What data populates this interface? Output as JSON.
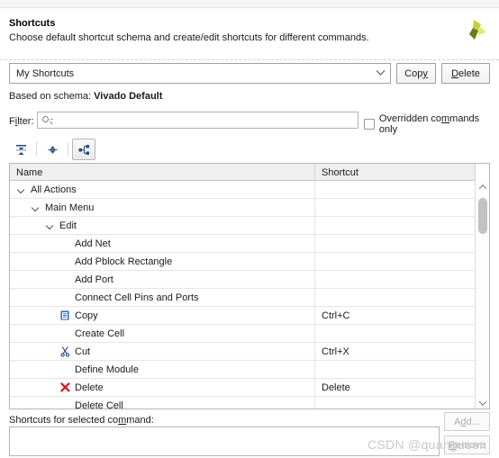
{
  "header": {
    "title": "Shortcuts",
    "subtitle": "Choose default shortcut schema and create/edit shortcuts for different commands.",
    "logo_icon": "vivado-pinwheel-logo-icon",
    "logo_colors": [
      "#a9b318",
      "#d7e14a",
      "#6e7a12"
    ]
  },
  "schema": {
    "combo_value": "My Shortcuts",
    "combo_icon": "chevron-down-icon",
    "copy_label_pre": "Cop",
    "copy_label_mn": "y",
    "delete_label_mn": "D",
    "delete_label_post": "elete",
    "based_on_prefix": "Based on schema: ",
    "based_on_value": "Vivado Default"
  },
  "filter": {
    "label_pre": "F",
    "label_mn": "i",
    "label_post": "lter:",
    "placeholder": "",
    "value": "",
    "search_icon": "search-icon",
    "checkbox_checked": false,
    "checkbox_label_pre": "Overridden co",
    "checkbox_label_mn": "m",
    "checkbox_label_post": "mands only"
  },
  "toolbar": {
    "buttons": [
      {
        "name": "collapse-all-icon",
        "pressed": false
      },
      {
        "name": "expand-all-icon",
        "pressed": false
      },
      {
        "name": "tree-hierarchy-icon",
        "pressed": true
      }
    ]
  },
  "table": {
    "columns": [
      "Name",
      "Shortcut"
    ],
    "rows": [
      {
        "label": "All Actions",
        "shortcut": "",
        "indent": 0,
        "twisty": true,
        "icon": ""
      },
      {
        "label": "Main Menu",
        "shortcut": "",
        "indent": 1,
        "twisty": true,
        "icon": ""
      },
      {
        "label": "Edit",
        "shortcut": "",
        "indent": 2,
        "twisty": true,
        "icon": ""
      },
      {
        "label": "Add Net",
        "shortcut": "",
        "indent": 3,
        "twisty": false,
        "icon": ""
      },
      {
        "label": "Add Pblock Rectangle",
        "shortcut": "",
        "indent": 3,
        "twisty": false,
        "icon": ""
      },
      {
        "label": "Add Port",
        "shortcut": "",
        "indent": 3,
        "twisty": false,
        "icon": ""
      },
      {
        "label": "Connect Cell Pins and Ports",
        "shortcut": "",
        "indent": 3,
        "twisty": false,
        "icon": ""
      },
      {
        "label": "Copy",
        "shortcut": "Ctrl+C",
        "indent": 3,
        "twisty": false,
        "icon": "copy-icon"
      },
      {
        "label": "Create Cell",
        "shortcut": "",
        "indent": 3,
        "twisty": false,
        "icon": ""
      },
      {
        "label": "Cut",
        "shortcut": "Ctrl+X",
        "indent": 3,
        "twisty": false,
        "icon": "cut-icon"
      },
      {
        "label": "Define Module",
        "shortcut": "",
        "indent": 3,
        "twisty": false,
        "icon": ""
      },
      {
        "label": "Delete",
        "shortcut": "Delete",
        "indent": 3,
        "twisty": false,
        "icon": "delete-icon"
      },
      {
        "label": "Delete Cell",
        "shortcut": "",
        "indent": 3,
        "twisty": false,
        "icon": ""
      }
    ],
    "scrollbar": {
      "up_icon": "chevron-up-icon",
      "down_icon": "chevron-down-icon"
    }
  },
  "bottom": {
    "label_pre": "Shortcuts for selected co",
    "label_mn": "m",
    "label_post": "mand:",
    "list_value": "",
    "add_label_pre": "A",
    "add_label_mn": "d",
    "add_label_post": "d...",
    "remove_label_pre": "",
    "remove_label_mn": "R",
    "remove_label_post": "emove"
  },
  "watermark": {
    "text": "CSDN @quangueen"
  }
}
